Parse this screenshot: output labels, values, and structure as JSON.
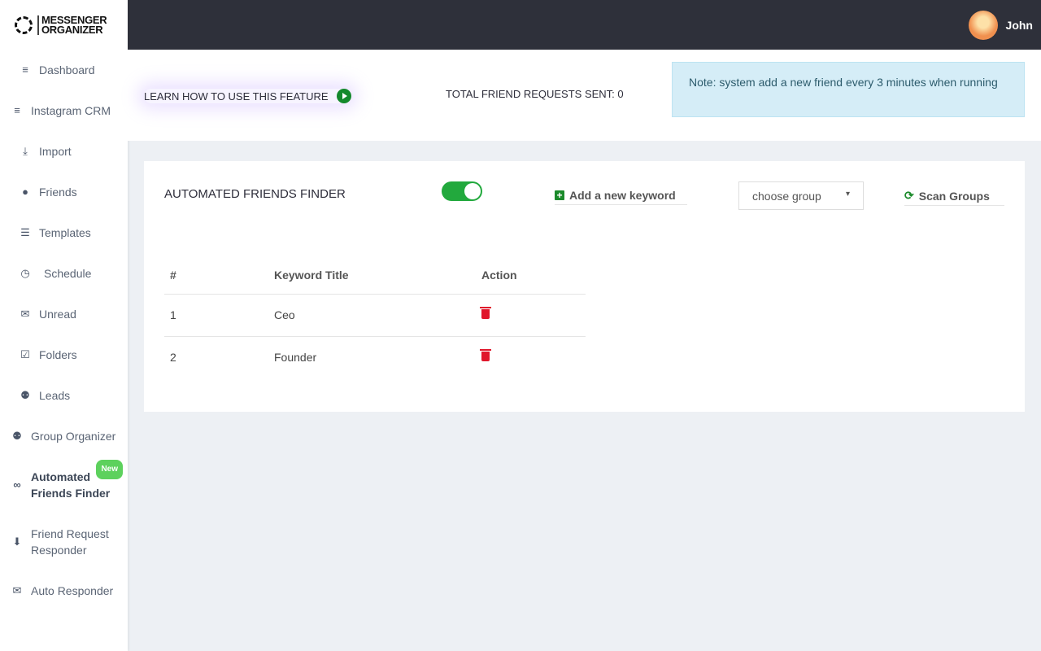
{
  "brand": {
    "line1": "MESSENGER",
    "line2": "ORGANIZER"
  },
  "user": {
    "name": "John"
  },
  "sidebar": {
    "items": [
      {
        "label": "Dashboard",
        "icon": "database-icon"
      },
      {
        "label": "Instagram CRM",
        "icon": "database-icon"
      },
      {
        "label": "Import",
        "icon": "download-icon"
      },
      {
        "label": "Friends",
        "icon": "user-icon"
      },
      {
        "label": "Templates",
        "icon": "list-icon"
      },
      {
        "label": "Schedule",
        "icon": "clock-icon"
      },
      {
        "label": "Unread",
        "icon": "envelope-icon"
      },
      {
        "label": "Folders",
        "icon": "check-square-icon"
      },
      {
        "label": "Leads",
        "icon": "users-icon"
      },
      {
        "label": "Group Organizer",
        "icon": "users-icon"
      },
      {
        "label": "Automated Friends Finder",
        "icon": "binoculars-icon",
        "badge": "New",
        "active": true
      },
      {
        "label": "Friend Request Responder",
        "icon": "arrow-circle-down-icon"
      },
      {
        "label": "Auto Responder",
        "icon": "envelope-open-icon"
      }
    ]
  },
  "info": {
    "learn": "LEARN HOW TO USE THIS FEATURE",
    "total": "TOTAL FRIEND REQUESTS SENT: 0",
    "note": "Note: system add a new friend every 3 minutes when running"
  },
  "card": {
    "title": "AUTOMATED FRIENDS FINDER",
    "toggle_on": true,
    "add_keyword": "Add a new keyword",
    "select_value": "choose group",
    "scan": "Scan Groups",
    "columns": [
      "#",
      "Keyword Title",
      "Action"
    ],
    "rows": [
      {
        "n": "1",
        "title": "Ceo"
      },
      {
        "n": "2",
        "title": "Founder"
      }
    ]
  }
}
